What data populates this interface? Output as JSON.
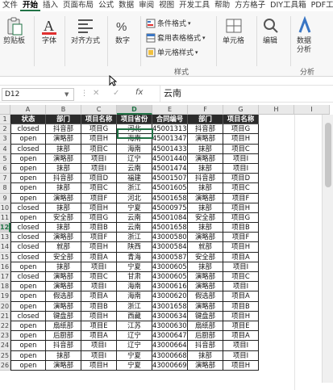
{
  "ribbon_tabs": [
    "文件",
    "开始",
    "插入",
    "页面布局",
    "公式",
    "数据",
    "审阅",
    "视图",
    "开发工具",
    "帮助",
    "方方格子",
    "DIY工具箱",
    "PDF工具集"
  ],
  "active_tab_index": 1,
  "ribbon": {
    "clipboard_label": "剪贴板",
    "font_label": "字体",
    "alignment_label": "对齐方式",
    "number_label": "数字",
    "conditional_format_label": "条件格式",
    "table_format_label": "套用表格格式",
    "cell_style_label": "单元格样式",
    "styles_group_label": "样式",
    "cells_label": "单元格",
    "edit_label": "编辑",
    "data_analysis_label": "数据分析",
    "analysis_group_label": "分析"
  },
  "formula_bar": {
    "name_box": "D12",
    "formula_value": "云南",
    "fx_label": "fx",
    "cancel_glyph": "✕",
    "confirm_glyph": "✓",
    "dots_glyph": "⋮"
  },
  "sheet": {
    "selected_cell": "D12",
    "column_letters": [
      "A",
      "B",
      "C",
      "D",
      "E",
      "F",
      "G",
      "H",
      "I"
    ],
    "row_numbers": [
      "1",
      "2",
      "3",
      "4",
      "5",
      "6",
      "7",
      "8",
      "9",
      "10",
      "11",
      "12",
      "13",
      "14",
      "15",
      "16",
      "17",
      "18",
      "19",
      "20",
      "21",
      "22",
      "23",
      "24",
      "25",
      "26"
    ],
    "headers": [
      "状态",
      "部门",
      "项目名称",
      "项目省份",
      "合同编号",
      "部门",
      "项目名称"
    ],
    "rows": [
      [
        "closed",
        "抖音部",
        "项目G",
        "河北",
        "4500131365",
        "抖音部",
        "项目G"
      ],
      [
        "open",
        "演略部",
        "项目H",
        "海南",
        "4500134791",
        "演略部",
        "项目H"
      ],
      [
        "closed",
        "抹部",
        "项目C",
        "海南",
        "4500143319",
        "抹部",
        "项目C"
      ],
      [
        "open",
        "演略部",
        "项目I",
        "辽宁",
        "4500144088",
        "演略部",
        "项目I"
      ],
      [
        "open",
        "抹部",
        "项目I",
        "云南",
        "4500147463",
        "抹部",
        "项目I"
      ],
      [
        "open",
        "抖音部",
        "项目D",
        "福建",
        "4500150767",
        "抖音部",
        "项目D"
      ],
      [
        "open",
        "抹部",
        "项目C",
        "浙江",
        "4500160511",
        "抹部",
        "项目C"
      ],
      [
        "open",
        "演略部",
        "项目F",
        "河北",
        "4500165850",
        "演略部",
        "项目F"
      ],
      [
        "closed",
        "抹部",
        "项目H",
        "宁夏",
        "4500097566",
        "抹部",
        "项目H"
      ],
      [
        "open",
        "安全部",
        "项目G",
        "云南",
        "4500108400",
        "安全部",
        "项目G"
      ],
      [
        "closed",
        "抹部",
        "项目B",
        "云南",
        "4500165850",
        "抹部",
        "项目B"
      ],
      [
        "closed",
        "演略部",
        "项目F",
        "浙江",
        "4300058008",
        "演略部",
        "项目F"
      ],
      [
        "closed",
        "就部",
        "项目H",
        "陕西",
        "4300058431",
        "就部",
        "项目H"
      ],
      [
        "closed",
        "安全部",
        "项目A",
        "青海",
        "4300058720",
        "安全部",
        "项目A"
      ],
      [
        "open",
        "抹部",
        "项目I",
        "宁夏",
        "4300060532",
        "抹部",
        "项目I"
      ],
      [
        "closed",
        "演略部",
        "项目C",
        "甘肃",
        "4300060533",
        "演略部",
        "项目C"
      ],
      [
        "open",
        "演略部",
        "项目I",
        "海南",
        "4300061696",
        "演略部",
        "项目I"
      ],
      [
        "open",
        "假选部",
        "项目A",
        "海南",
        "4300062021",
        "假选部",
        "项目A"
      ],
      [
        "open",
        "演略部",
        "项目B",
        "浙江",
        "4300165850",
        "演略部",
        "项目B"
      ],
      [
        "closed",
        "键盘部",
        "项目H",
        "西藏",
        "4300063417",
        "键盘部",
        "项目H"
      ],
      [
        "open",
        "扇纸部",
        "项目E",
        "江苏",
        "4300063072",
        "扇纸部",
        "项目E"
      ],
      [
        "open",
        "后厨部",
        "项目A",
        "辽宁",
        "4300064778",
        "后厨部",
        "项目A"
      ],
      [
        "open",
        "抖音部",
        "项目I",
        "辽宁",
        "4300066475",
        "抖音部",
        "项目I"
      ],
      [
        "open",
        "抹部",
        "项目I",
        "宁夏",
        "4300066824",
        "抹部",
        "项目I"
      ],
      [
        "open",
        "演略部",
        "项目H",
        "宁夏",
        "4300066990",
        "演略部",
        "项目H"
      ]
    ]
  },
  "colors": {
    "accent": "#217346",
    "header_bg": "#2b2b2b",
    "header_text": "#ffffff"
  }
}
